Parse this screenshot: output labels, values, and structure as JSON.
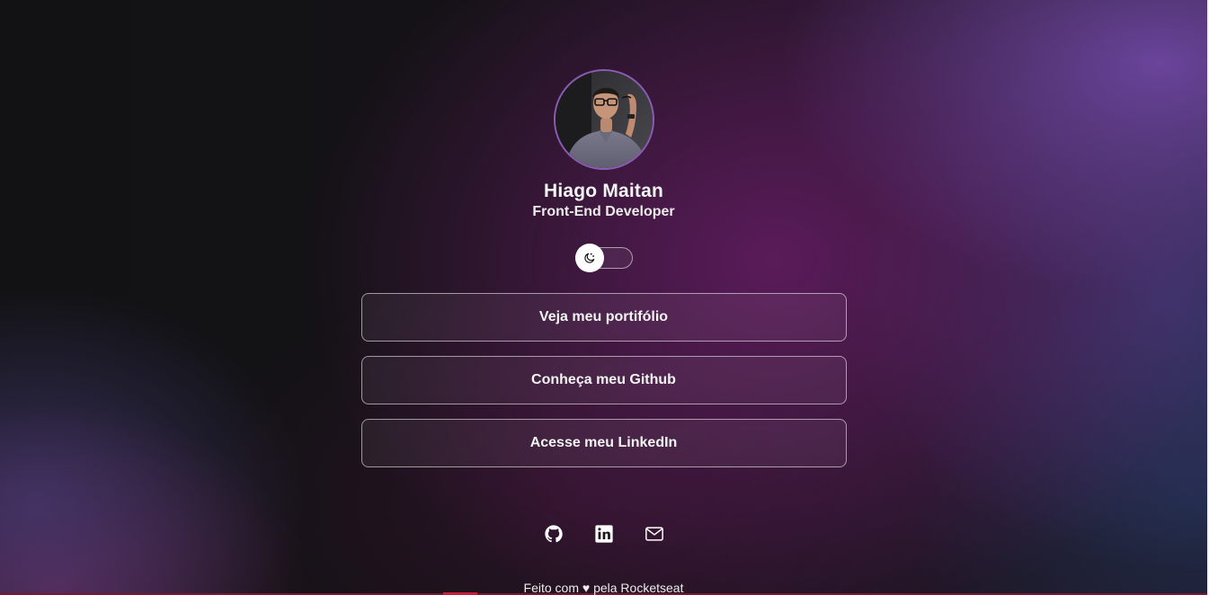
{
  "profile": {
    "name": "Hiago Maitan",
    "role": "Front-End Developer"
  },
  "theme_toggle": {
    "icon": "moon-icon",
    "state": "dark"
  },
  "links": [
    {
      "label": "Veja meu portifólio"
    },
    {
      "label": "Conheça meu Github"
    },
    {
      "label": "Acesse meu LinkedIn"
    }
  ],
  "socials": [
    {
      "icon": "github-icon"
    },
    {
      "icon": "linkedin-icon"
    },
    {
      "icon": "mail-icon"
    }
  ],
  "footer": {
    "text": "Feito com ♥ pela Rocketseat"
  },
  "colors": {
    "text": "#f4f4f5",
    "accent_purple": "#8c5bb4",
    "background": "#121214"
  }
}
